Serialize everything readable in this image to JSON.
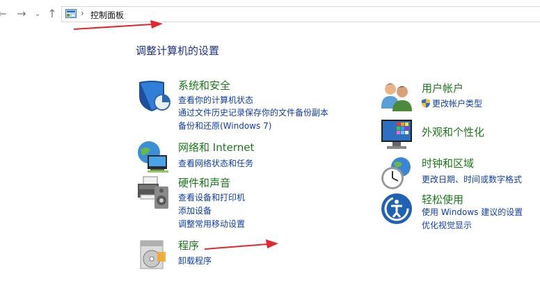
{
  "nav": {
    "back": "←",
    "forward": "→",
    "recent": "⌄",
    "up": "↑"
  },
  "address": {
    "separator": "›",
    "path": "控制面板",
    "icon": "control-panel-icon"
  },
  "page_title": "调整计算机的设置",
  "categories": {
    "system_security": {
      "title": "系统和安全",
      "icon": "system-security-shield-icon",
      "links": [
        "查看你的计算机状态",
        "通过文件历史记录保存你的文件备份副本",
        "备份和还原(Windows 7)"
      ]
    },
    "network": {
      "title": "网络和 Internet",
      "icon": "network-globe-icon",
      "links": [
        "查看网络状态和任务"
      ]
    },
    "hardware": {
      "title": "硬件和声音",
      "icon": "printer-speaker-icon",
      "links": [
        "查看设备和打印机",
        "添加设备",
        "调整常用移动设置"
      ]
    },
    "programs": {
      "title": "程序",
      "icon": "programs-disc-icon",
      "links": [
        "卸载程序"
      ]
    },
    "user_accounts": {
      "title": "用户帐户",
      "icon": "users-icon",
      "links": [
        "更改帐户类型"
      ]
    },
    "appearance": {
      "title": "外观和个性化",
      "icon": "monitor-palette-icon",
      "links": []
    },
    "clock_region": {
      "title": "时钟和区域",
      "icon": "clock-globe-icon",
      "links": [
        "更改日期、时间或数字格式"
      ]
    },
    "ease_access": {
      "title": "轻松使用",
      "icon": "ease-of-access-icon",
      "links": [
        "使用 Windows 建议的设置",
        "优化视觉显示"
      ]
    }
  },
  "colors": {
    "category_title": "#1a7a1a",
    "link": "#0f3ea8",
    "page_title": "#1e3287",
    "annotation_arrow": "#e3272b"
  }
}
